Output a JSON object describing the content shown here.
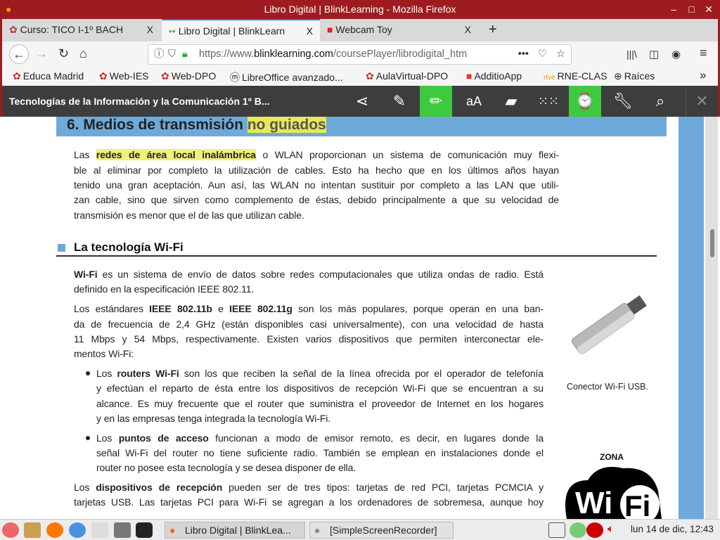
{
  "window": {
    "title": "Libro Digital | BlinkLearning - Mozilla Firefox",
    "controls": [
      "–",
      "□",
      "✕"
    ]
  },
  "tabs": [
    {
      "label": "Curso: TICO I-1º BACH",
      "close": "X"
    },
    {
      "label": "Libro Digital | BlinkLearn",
      "close": "X",
      "active": true
    },
    {
      "label": "Webcam Toy",
      "close": "X"
    }
  ],
  "new_tab": "+",
  "nav": {
    "back": "←",
    "forward": "→",
    "reload": "↻",
    "home": "⌂",
    "url_prefix": "https://www.",
    "url_domain": "blinklearning.com",
    "url_path": "/coursePlayer/librodigital_htm",
    "more": "•••",
    "library": "|||\\",
    "sidebar": "◫",
    "account": "◉",
    "menu": "≡"
  },
  "bookmarks": [
    "Educa Madrid",
    "Web-IES",
    "Web-DPO",
    "LibreOffice avanzado...",
    "AulaVirtual-DPO",
    "AdditioApp",
    "RNE-CLAS",
    "Raíces"
  ],
  "bookmarks_more": "»",
  "app_toolbar": {
    "title": "Tecnologías de la Información y la Comunicación 1º B...",
    "icons": [
      "share-icon",
      "pencil-icon",
      "highlighter-icon",
      "font-size-icon",
      "notes-icon",
      "grid-icon",
      "stopwatch-icon",
      "wrench-icon",
      "search-icon",
      "close-icon"
    ],
    "accent": "#3ec93e",
    "font_label": "aA",
    "close": "✕"
  },
  "doc": {
    "heading": {
      "main": "6. Medios de transmisión ",
      "highlight": "no guiados"
    },
    "section": "La tecnología Wi-Fi",
    "caption": "Conector Wi-Fi USB.",
    "zona": "ZONA",
    "wifi_logo": "WiFi",
    "p1": [
      [
        {
          "t": "Las "
        },
        {
          "t": "redes de área local inalámbrica",
          "y": 1
        },
        {
          "t": " o WLAN proporcionan un sistema de comunicación muy flexi-"
        }
      ],
      [
        {
          "t": "ble al eliminar por completo la utilización de cables. Esto ha hecho que en los últimos años hayan"
        }
      ],
      [
        {
          "t": "tenido una gran aceptación. Aun así, las WLAN no intentan sustituir por completo a las LAN que utili-"
        }
      ],
      [
        {
          "t": "zan cable, sino que sirven como complemento de éstas, debido principalmente a que su velocidad de"
        }
      ],
      [
        {
          "t": "transmisión es menor que el de las que utilizan cable."
        }
      ]
    ],
    "p2": [
      [
        {
          "t": "Wi-Fi",
          "b": 1
        },
        {
          "t": " es un sistema de envío de datos sobre redes computacionales que utiliza ondas de radio. Está"
        }
      ],
      [
        {
          "t": "definido en la especificación IEEE 802.11."
        }
      ]
    ],
    "p3": [
      [
        {
          "t": "Los estándares "
        },
        {
          "t": "IEEE 802.11b",
          "b": 1
        },
        {
          "t": " e "
        },
        {
          "t": "IEEE 802.11g",
          "b": 1
        },
        {
          "t": " son los más populares, porque operan en una ban-"
        }
      ],
      [
        {
          "t": "da de frecuencia de 2,4 GHz (están disponibles casi universalmente), con una velocidad de hasta"
        }
      ],
      [
        {
          "t": "11 Mbps y 54 Mbps, respectivamente. Existen varios dispositivos que permiten interconectar ele-"
        }
      ],
      [
        {
          "t": "mentos Wi-Fi:"
        }
      ]
    ],
    "b1": [
      [
        {
          "t": "Los "
        },
        {
          "t": "routers Wi-Fi",
          "b": 1
        },
        {
          "t": " son los que reciben la señal de la línea ofrecida por el operador de telefonía"
        }
      ],
      [
        {
          "t": "y efectúan el reparto de ésta entre los dispositivos de recepción Wi-Fi que se encuentran a su"
        }
      ],
      [
        {
          "t": "alcance. Es muy frecuente que el router que suministra el proveedor de Internet en los hogares"
        }
      ],
      [
        {
          "t": "y en las empresas tenga integrada la tecnología Wi-Fi."
        }
      ]
    ],
    "b2": [
      [
        {
          "t": "Los "
        },
        {
          "t": "puntos de acceso",
          "b": 1
        },
        {
          "t": " funcionan a modo de emisor remoto, es decir, en lugares donde la"
        }
      ],
      [
        {
          "t": "señal Wi-Fi del router no tiene suficiente radio. También se emplean en instalaciones donde el"
        }
      ],
      [
        {
          "t": "router no posee esta tecnología y se desea disponer de ella."
        }
      ]
    ],
    "p4": [
      [
        {
          "t": "Los "
        },
        {
          "t": "dispositivos de recepción",
          "b": 1
        },
        {
          "t": " pueden ser de tres tipos: tarjetas de red PCI, tarjetas PCMCIA y"
        }
      ],
      [
        {
          "t": "tarjetas USB. Las tarjetas PCI para Wi-Fi se agregan a los ordenadores de sobremesa, aunque hoy"
        }
      ]
    ]
  },
  "taskbar": {
    "windows": [
      "Libro Digital | BlinkLea...",
      "[SimpleScreenRecorder]"
    ],
    "clock": "lun 14 de dic, 12:43"
  }
}
